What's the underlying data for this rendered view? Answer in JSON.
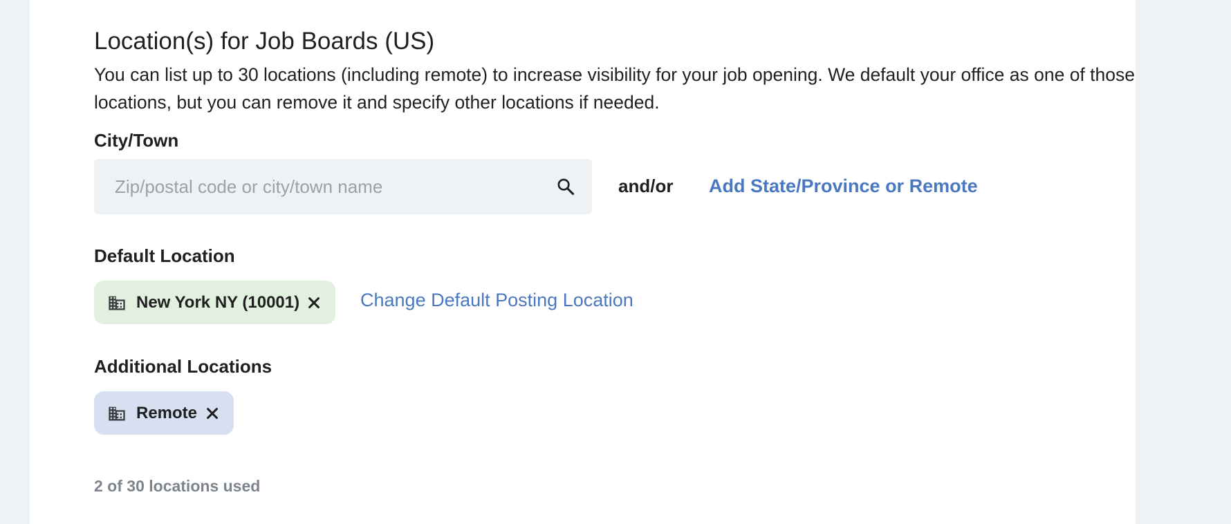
{
  "section": {
    "title": "Location(s) for Job Boards (US)",
    "description": "You can list up to 30 locations (including remote) to increase visibility for your job opening. We default your office as one of those locations, but you can remove it and specify other locations if needed."
  },
  "city_field": {
    "label": "City/Town",
    "placeholder": "Zip/postal code or city/town name",
    "value": "",
    "icon": "search-icon"
  },
  "andor_text": "and/or",
  "add_state_link": "Add State/Province or Remote",
  "default_location": {
    "label": "Default Location",
    "chip_label": "New York NY (10001)",
    "chip_icon": "building-icon",
    "chip_color": "#e2f1df",
    "change_link": "Change Default Posting Location"
  },
  "additional_locations": {
    "label": "Additional Locations",
    "chips": [
      {
        "label": "Remote",
        "icon": "building-icon",
        "color": "#d6e0f0"
      }
    ]
  },
  "usage": {
    "text": "2 of 30 locations used",
    "used": 2,
    "max": 30
  },
  "colors": {
    "link": "#4a78c0",
    "page_background": "#eef2f5",
    "muted_text": "#7d848c"
  }
}
